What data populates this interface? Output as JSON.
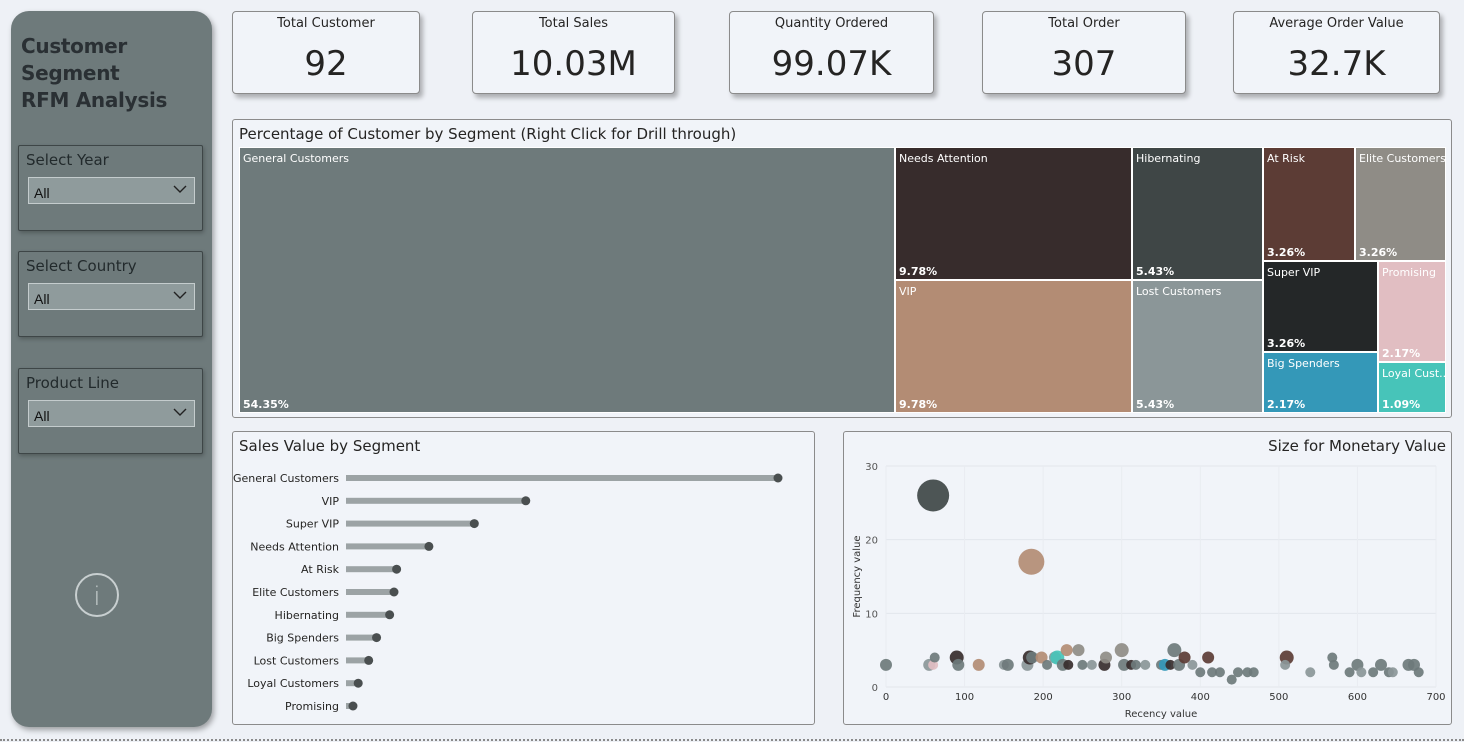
{
  "sidebar": {
    "title_line1": "Customer Segment",
    "title_line2": "RFM Analysis",
    "slicers": [
      {
        "label": "Select Year",
        "value": "All"
      },
      {
        "label": "Select Country",
        "value": "All"
      },
      {
        "label": "Product Line",
        "value": "All"
      }
    ],
    "info_glyph": "i"
  },
  "kpis": [
    {
      "label": "Total Customer",
      "value": "92"
    },
    {
      "label": "Total Sales",
      "value": "10.03M"
    },
    {
      "label": "Quantity Ordered",
      "value": "99.07K"
    },
    {
      "label": "Total Order",
      "value": "307"
    },
    {
      "label": "Average Order Value",
      "value": "32.7K"
    }
  ],
  "treemap": {
    "title": "Percentage of Customer by Segment (Right Click for Drill through)",
    "tiles": [
      {
        "name": "General Customers",
        "pct": "54.35%",
        "color": "#6e7a7b"
      },
      {
        "name": "Needs Attention",
        "pct": "9.78%",
        "color": "#372c2c"
      },
      {
        "name": "VIP",
        "pct": "9.78%",
        "color": "#b38c74"
      },
      {
        "name": "Hibernating",
        "pct": "5.43%",
        "color": "#3f4646"
      },
      {
        "name": "Lost Customers",
        "pct": "5.43%",
        "color": "#8b9698"
      },
      {
        "name": "At Risk",
        "pct": "3.26%",
        "color": "#5c3c35"
      },
      {
        "name": "Elite Customers",
        "pct": "3.26%",
        "color": "#8f8c86"
      },
      {
        "name": "Super VIP",
        "pct": "3.26%",
        "color": "#242728"
      },
      {
        "name": "Promising",
        "pct": "2.17%",
        "color": "#e1bec2"
      },
      {
        "name": "Big Spenders",
        "pct": "2.17%",
        "color": "#3498b8"
      },
      {
        "name": "Loyal Cust...",
        "pct": "1.09%",
        "color": "#47c4b9"
      }
    ]
  },
  "sales_panel": {
    "title": "Sales Value by Segment"
  },
  "scatter_panel": {
    "title": "Size for Monetary Value"
  },
  "chart_data": [
    {
      "type": "bar",
      "title": "Sales Value by Segment",
      "categories": [
        "General Customers",
        "VIP",
        "Super VIP",
        "Needs Attention",
        "At Risk",
        "Elite Customers",
        "Hibernating",
        "Big Spenders",
        "Lost Customers",
        "Loyal Customers",
        "Promising"
      ],
      "values": [
        4.95,
        2.06,
        1.47,
        0.95,
        0.58,
        0.55,
        0.5,
        0.35,
        0.26,
        0.14,
        0.08
      ],
      "bar_color": "#9ca3a5",
      "dot_color": "#4a4f50"
    },
    {
      "type": "scatter",
      "title": "Size for Monetary Value",
      "xlabel": "Recency value",
      "ylabel": "Frequency value",
      "xlim": [
        0,
        700
      ],
      "ylim": [
        0,
        30
      ],
      "xticks": [
        0,
        100,
        200,
        300,
        400,
        500,
        600,
        700
      ],
      "yticks": [
        0,
        10,
        20,
        30
      ],
      "points": [
        {
          "x": 60,
          "y": 26,
          "s": 16,
          "color": "#3f4646"
        },
        {
          "x": 185,
          "y": 17,
          "s": 13,
          "color": "#b38c74"
        },
        {
          "x": 0,
          "y": 3,
          "s": 6,
          "color": "#6e7a7b"
        },
        {
          "x": 55,
          "y": 3,
          "s": 6,
          "color": "#8b9698"
        },
        {
          "x": 60,
          "y": 3,
          "s": 5,
          "color": "#e1bec2"
        },
        {
          "x": 62,
          "y": 4,
          "s": 5,
          "color": "#6e7a7b"
        },
        {
          "x": 90,
          "y": 4,
          "s": 7,
          "color": "#372c2c"
        },
        {
          "x": 92,
          "y": 3,
          "s": 6,
          "color": "#6e7a7b"
        },
        {
          "x": 118,
          "y": 3,
          "s": 6,
          "color": "#b38c74"
        },
        {
          "x": 150,
          "y": 3,
          "s": 5,
          "color": "#8b9698"
        },
        {
          "x": 155,
          "y": 3,
          "s": 6,
          "color": "#6e7a7b"
        },
        {
          "x": 180,
          "y": 3,
          "s": 6,
          "color": "#8b9698"
        },
        {
          "x": 183,
          "y": 4,
          "s": 7,
          "color": "#372c2c"
        },
        {
          "x": 186,
          "y": 4,
          "s": 6,
          "color": "#6e7a7b"
        },
        {
          "x": 198,
          "y": 4,
          "s": 6,
          "color": "#b38c74"
        },
        {
          "x": 205,
          "y": 3,
          "s": 5,
          "color": "#6e7a7b"
        },
        {
          "x": 215,
          "y": 4,
          "s": 6,
          "color": "#8b9698"
        },
        {
          "x": 218,
          "y": 4,
          "s": 7,
          "color": "#47c4b9"
        },
        {
          "x": 225,
          "y": 3,
          "s": 6,
          "color": "#6e7a7b"
        },
        {
          "x": 230,
          "y": 5,
          "s": 6,
          "color": "#b38c74"
        },
        {
          "x": 232,
          "y": 3,
          "s": 5,
          "color": "#372c2c"
        },
        {
          "x": 245,
          "y": 5,
          "s": 6,
          "color": "#8f8c86"
        },
        {
          "x": 250,
          "y": 3,
          "s": 5,
          "color": "#6e7a7b"
        },
        {
          "x": 262,
          "y": 3,
          "s": 5,
          "color": "#8b9698"
        },
        {
          "x": 278,
          "y": 3,
          "s": 6,
          "color": "#372c2c"
        },
        {
          "x": 280,
          "y": 4,
          "s": 6,
          "color": "#8f8c86"
        },
        {
          "x": 300,
          "y": 5,
          "s": 7,
          "color": "#8f8c86"
        },
        {
          "x": 303,
          "y": 3,
          "s": 6,
          "color": "#6e7a7b"
        },
        {
          "x": 312,
          "y": 3,
          "s": 5,
          "color": "#372c2c"
        },
        {
          "x": 318,
          "y": 3,
          "s": 5,
          "color": "#6e7a7b"
        },
        {
          "x": 330,
          "y": 3,
          "s": 5,
          "color": "#8b9698"
        },
        {
          "x": 350,
          "y": 3,
          "s": 5,
          "color": "#6e7a7b"
        },
        {
          "x": 355,
          "y": 3,
          "s": 6,
          "color": "#3498b8"
        },
        {
          "x": 362,
          "y": 3,
          "s": 5,
          "color": "#372c2c"
        },
        {
          "x": 367,
          "y": 5,
          "s": 7,
          "color": "#6e7a7b"
        },
        {
          "x": 373,
          "y": 3,
          "s": 6,
          "color": "#6e7a7b"
        },
        {
          "x": 380,
          "y": 4,
          "s": 6,
          "color": "#5c3c35"
        },
        {
          "x": 390,
          "y": 3,
          "s": 5,
          "color": "#8b9698"
        },
        {
          "x": 400,
          "y": 2,
          "s": 5,
          "color": "#6e7a7b"
        },
        {
          "x": 410,
          "y": 4,
          "s": 6,
          "color": "#5c3c35"
        },
        {
          "x": 415,
          "y": 2,
          "s": 5,
          "color": "#6e7a7b"
        },
        {
          "x": 425,
          "y": 2,
          "s": 5,
          "color": "#6e7a7b"
        },
        {
          "x": 440,
          "y": 1,
          "s": 5,
          "color": "#6e7a7b"
        },
        {
          "x": 448,
          "y": 2,
          "s": 5,
          "color": "#6e7a7b"
        },
        {
          "x": 460,
          "y": 2,
          "s": 5,
          "color": "#6e7a7b"
        },
        {
          "x": 468,
          "y": 2,
          "s": 5,
          "color": "#6e7a7b"
        },
        {
          "x": 510,
          "y": 4,
          "s": 7,
          "color": "#5c3c35"
        },
        {
          "x": 508,
          "y": 3,
          "s": 5,
          "color": "#8b9698"
        },
        {
          "x": 540,
          "y": 2,
          "s": 5,
          "color": "#8b9698"
        },
        {
          "x": 568,
          "y": 4,
          "s": 5,
          "color": "#6e7a7b"
        },
        {
          "x": 570,
          "y": 3,
          "s": 5,
          "color": "#6e7a7b"
        },
        {
          "x": 590,
          "y": 2,
          "s": 5,
          "color": "#6e7a7b"
        },
        {
          "x": 600,
          "y": 3,
          "s": 6,
          "color": "#6e7a7b"
        },
        {
          "x": 605,
          "y": 2,
          "s": 5,
          "color": "#8b9698"
        },
        {
          "x": 620,
          "y": 2,
          "s": 5,
          "color": "#6e7a7b"
        },
        {
          "x": 630,
          "y": 3,
          "s": 6,
          "color": "#6e7a7b"
        },
        {
          "x": 640,
          "y": 2,
          "s": 5,
          "color": "#6e7a7b"
        },
        {
          "x": 645,
          "y": 2,
          "s": 5,
          "color": "#8b9698"
        },
        {
          "x": 665,
          "y": 3,
          "s": 6,
          "color": "#6e7a7b"
        },
        {
          "x": 672,
          "y": 3,
          "s": 6,
          "color": "#6e7a7b"
        },
        {
          "x": 678,
          "y": 2,
          "s": 5,
          "color": "#6e7a7b"
        }
      ]
    }
  ]
}
